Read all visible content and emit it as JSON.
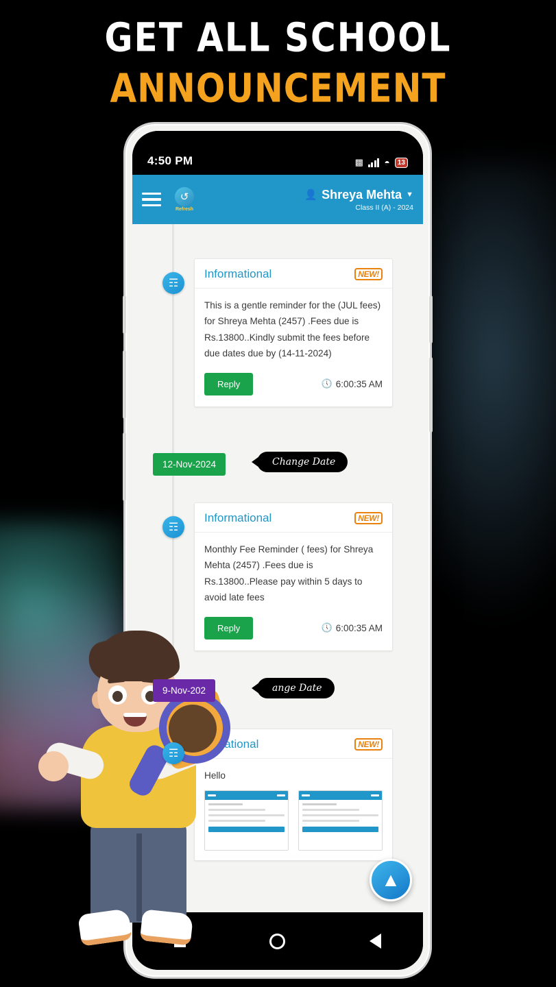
{
  "headline": {
    "line1": "GET ALL SCHOOL",
    "line2": "ANNOUNCEMENT"
  },
  "colors": {
    "headline_white": "#ffffff",
    "headline_orange": "#f5a31e",
    "app_bar": "#2196c9",
    "reply_green": "#1aa34a",
    "date_chip_green": "#1aa34a",
    "date_chip_purple": "#6a2aa8",
    "new_badge": "#e8820c"
  },
  "status_bar": {
    "time": "4:50 PM",
    "sim_icon": "sim-icon",
    "signal_icon": "signal-bars-icon",
    "wifi_icon": "wifi-icon",
    "battery_text": "13"
  },
  "app_bar": {
    "menu_icon": "hamburger-menu-icon",
    "refresh_icon": "refresh-icon",
    "refresh_label": "Refresh",
    "user_icon": "user-avatar-icon",
    "user_name": "Shreya Mehta",
    "caret_icon": "chevron-down-icon",
    "user_class": "Class II (A) - 2024"
  },
  "feed": {
    "announcements": [
      {
        "icon": "announcement-icon",
        "title": "Informational",
        "badge": "NEW!",
        "body": "This is a gentle reminder for the (JUL fees) for Shreya Mehta (2457) .Fees due is Rs.13800..Kindly submit the fees before due dates due by (14-11-2024)",
        "reply_label": "Reply",
        "clock_icon": "clock-icon",
        "time": "6:00:35 AM"
      },
      {
        "icon": "announcement-icon",
        "title": "Informational",
        "badge": "NEW!",
        "body": "Monthly Fee Reminder ( fees) for Shreya Mehta (2457) .Fees due is Rs.13800..Please pay within 5 days to avoid late fees",
        "reply_label": "Reply",
        "clock_icon": "clock-icon",
        "time": "6:00:35 AM"
      },
      {
        "icon": "announcement-icon",
        "title": "ormational",
        "badge": "NEW!",
        "body": "Hello",
        "reply_label": "",
        "clock_icon": "clock-icon",
        "time": ""
      }
    ],
    "date_markers": [
      {
        "date": "12-Nov-2024",
        "change_label": "Change Date"
      },
      {
        "date": "9-Nov-202",
        "change_label": "ange Date"
      }
    ],
    "scroll_top_icon": "scroll-to-top-icon"
  },
  "nav_bar": {
    "recents_icon": "recent-apps-icon",
    "home_icon": "home-icon",
    "back_icon": "back-icon"
  }
}
